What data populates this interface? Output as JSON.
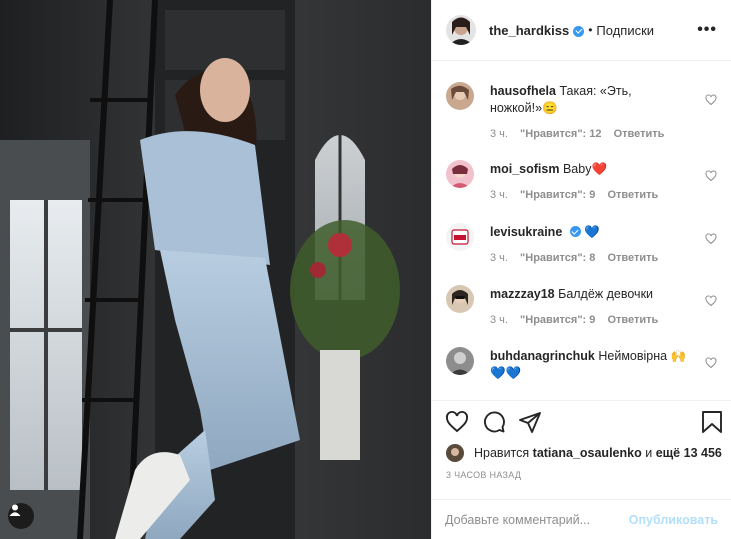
{
  "post": {
    "author": "the_hardkiss",
    "separator": "•",
    "follow_state": "Подписки",
    "more_label": "•••"
  },
  "comments": [
    {
      "username": "hausofhela",
      "text": "Такая: «Эть, ножкой!»😑",
      "time": "3 ч.",
      "likes": "\"Нравится\": 12",
      "reply": "Ответить"
    },
    {
      "username": "moi_sofism",
      "text": "Baby❤️",
      "time": "3 ч.",
      "likes": "\"Нравится\": 9",
      "reply": "Ответить"
    },
    {
      "username": "levisukraine",
      "text": "💙",
      "time": "3 ч.",
      "likes": "\"Нравится\": 8",
      "reply": "Ответить"
    },
    {
      "username": "mazzzay18",
      "text": "Балдёж девочки",
      "time": "3 ч.",
      "likes": "\"Нравится\": 9",
      "reply": "Ответить"
    },
    {
      "username": "buhdanagrinchuk",
      "text": "Неймовірна 🙌💙💙"
    }
  ],
  "likes_line": {
    "prefix": "Нравится",
    "user": "tatiana_osaulenko",
    "conj": "и",
    "rest": "ещё 13 456"
  },
  "timestamp": "3 ЧАСОВ НАЗАД",
  "comment_box": {
    "placeholder": "Добавьте комментарий...",
    "publish_label": "Опубликовать"
  },
  "colors": {
    "verified": "#3897f0",
    "publish_disabled": "#b2dffc",
    "meta_text": "#8e8e8e"
  },
  "icons": [
    "heart-icon",
    "comment-icon",
    "share-icon",
    "bookmark-icon",
    "more-icon",
    "verified-icon",
    "user-tag-icon"
  ]
}
